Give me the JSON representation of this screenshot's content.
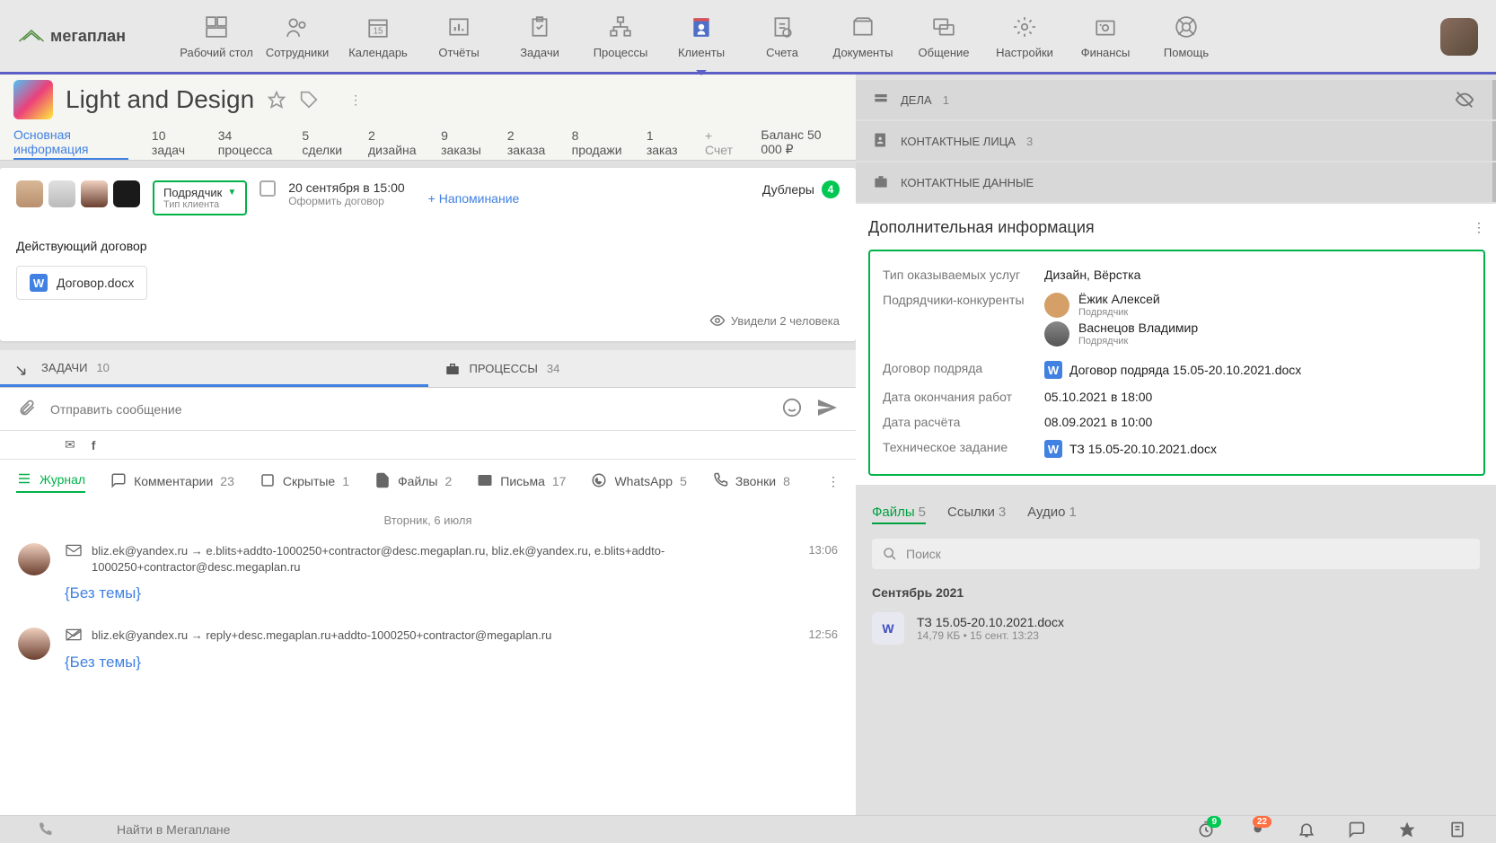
{
  "logo_text": "мегаплан",
  "nav": [
    {
      "label": "Рабочий стол",
      "icon": "dashboard",
      "active": false
    },
    {
      "label": "Сотрудники",
      "icon": "employees",
      "active": false
    },
    {
      "label": "Календарь",
      "icon": "calendar",
      "day": "15",
      "active": false
    },
    {
      "label": "Отчёты",
      "icon": "reports",
      "active": false
    },
    {
      "label": "Задачи",
      "icon": "tasks",
      "active": false
    },
    {
      "label": "Процессы",
      "icon": "processes",
      "active": false
    },
    {
      "label": "Клиенты",
      "icon": "clients",
      "active": true
    },
    {
      "label": "Счета",
      "icon": "invoices",
      "active": false
    },
    {
      "label": "Документы",
      "icon": "documents",
      "active": false
    },
    {
      "label": "Общение",
      "icon": "chat",
      "active": false
    },
    {
      "label": "Настройки",
      "icon": "settings",
      "active": false
    },
    {
      "label": "Финансы",
      "icon": "finance",
      "active": false
    },
    {
      "label": "Помощь",
      "icon": "help",
      "active": false
    }
  ],
  "client": {
    "name": "Light and Design",
    "type_value": "Подрядчик",
    "type_label": "Тип клиента",
    "event_time": "20 сентября в 15:00",
    "event_desc": "Оформить договор",
    "reminder": "+ Напоминание",
    "dup_label": "Дублеры",
    "dup_count": "4",
    "contract_label": "Действующий договор",
    "contract_file": "Договор.docx",
    "seen": "Увидели 2 человека"
  },
  "tabs": [
    {
      "label": "Основная информация",
      "active": true
    },
    {
      "label": "10 задач"
    },
    {
      "label": "34 процесса"
    },
    {
      "label": "5 сделки"
    },
    {
      "label": "2 дизайна"
    },
    {
      "label": "9 заказы"
    },
    {
      "label": "2 заказа"
    },
    {
      "label": "8 продажи"
    },
    {
      "label": "1 заказ"
    },
    {
      "label": "+ Счет",
      "new": true
    }
  ],
  "balance": "Баланс 50 000 ₽",
  "subtabs": {
    "tasks": {
      "label": "ЗАДАЧИ",
      "count": "10"
    },
    "processes": {
      "label": "ПРОЦЕССЫ",
      "count": "34"
    }
  },
  "compose": {
    "placeholder": "Отправить сообщение"
  },
  "journal_filters": [
    {
      "icon": "list",
      "label": "Журнал",
      "count": "",
      "active": true
    },
    {
      "icon": "comment",
      "label": "Комментарии",
      "count": "23"
    },
    {
      "icon": "hidden",
      "label": "Скрытые",
      "count": "1"
    },
    {
      "icon": "file",
      "label": "Файлы",
      "count": "2"
    },
    {
      "icon": "mail",
      "label": "Письма",
      "count": "17"
    },
    {
      "icon": "whatsapp",
      "label": "WhatsApp",
      "count": "5"
    },
    {
      "icon": "call",
      "label": "Звонки",
      "count": "8"
    }
  ],
  "feed": {
    "date": "Вторник, 6 июля",
    "items": [
      {
        "time": "13:06",
        "addr": "bliz.ek@yandex.ru → e.blits+addto-1000250+contractor@desc.megaplan.ru, bliz.ek@yandex.ru, e.blits+addto-1000250+contractor@desc.megaplan.ru",
        "subject": "{Без темы}",
        "crossed": false
      },
      {
        "time": "12:56",
        "addr": "bliz.ek@yandex.ru → reply+desc.megaplan.ru+addto-1000250+contractor@megaplan.ru",
        "subject": "{Без темы}",
        "crossed": true
      }
    ]
  },
  "right": {
    "sections": [
      {
        "label": "ДЕЛА",
        "count": "1",
        "icon": "cases"
      },
      {
        "label": "КОНТАКТНЫЕ ЛИЦА",
        "count": "3",
        "icon": "contacts"
      },
      {
        "label": "КОНТАКТНЫЕ ДАННЫЕ",
        "count": "",
        "icon": "data"
      }
    ],
    "addinfo_title": "Дополнительная информация",
    "fields": {
      "service_type": {
        "label": "Тип оказываемых услуг",
        "value": "Дизайн, Вёрстка"
      },
      "competitors": {
        "label": "Подрядчики-конкуренты",
        "items": [
          {
            "name": "Ёжик Алексей",
            "role": "Подрядчик"
          },
          {
            "name": "Васнецов Владимир",
            "role": "Подрядчик"
          }
        ]
      },
      "contract": {
        "label": "Договор подряда",
        "file": "Договор подряда 15.05-20.10.2021.docx"
      },
      "end_date": {
        "label": "Дата окончания работ",
        "value": "05.10.2021 в 18:00"
      },
      "pay_date": {
        "label": "Дата расчёта",
        "value": "08.09.2021 в 10:00"
      },
      "tz": {
        "label": "Техническое задание",
        "file": "ТЗ 15.05-20.10.2021.docx"
      }
    },
    "file_tabs": [
      {
        "label": "Файлы",
        "count": "5",
        "active": true
      },
      {
        "label": "Ссылки",
        "count": "3"
      },
      {
        "label": "Аудио",
        "count": "1"
      }
    ],
    "search_placeholder": "Поиск",
    "files_month": "Сентябрь 2021",
    "files": [
      {
        "name": "ТЗ 15.05-20.10.2021.docx",
        "meta": "14,79 КБ • 15 сент. 13:23"
      }
    ]
  },
  "bottombar": {
    "search_placeholder": "Найти в Мегаплане",
    "badge1": "9",
    "badge2": "22"
  }
}
